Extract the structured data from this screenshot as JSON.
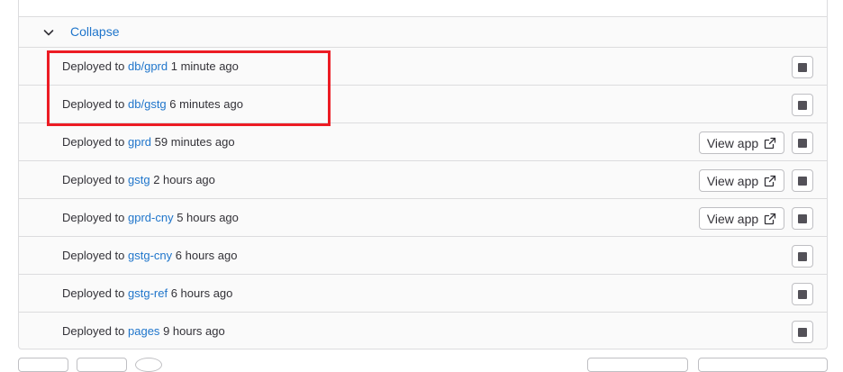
{
  "collapse": {
    "label": "Collapse"
  },
  "deploy_prefix": "Deployed to",
  "deployments": [
    {
      "env": "db/gprd",
      "time": "1 minute ago",
      "view_app": ""
    },
    {
      "env": "db/gstg",
      "time": "6 minutes ago",
      "view_app": ""
    },
    {
      "env": "gprd",
      "time": "59 minutes ago",
      "view_app": "View app"
    },
    {
      "env": "gstg",
      "time": "2 hours ago",
      "view_app": "View app"
    },
    {
      "env": "gprd-cny",
      "time": "5 hours ago",
      "view_app": "View app"
    },
    {
      "env": "gstg-cny",
      "time": "6 hours ago",
      "view_app": ""
    },
    {
      "env": "gstg-ref",
      "time": "6 hours ago",
      "view_app": ""
    },
    {
      "env": "pages",
      "time": "9 hours ago",
      "view_app": ""
    }
  ],
  "icons": {
    "collapse": "chevron-down-icon",
    "external": "external-link-icon",
    "stop": "stop-icon"
  },
  "colors": {
    "link": "#1f75cb",
    "highlight": "#ec1c24"
  }
}
